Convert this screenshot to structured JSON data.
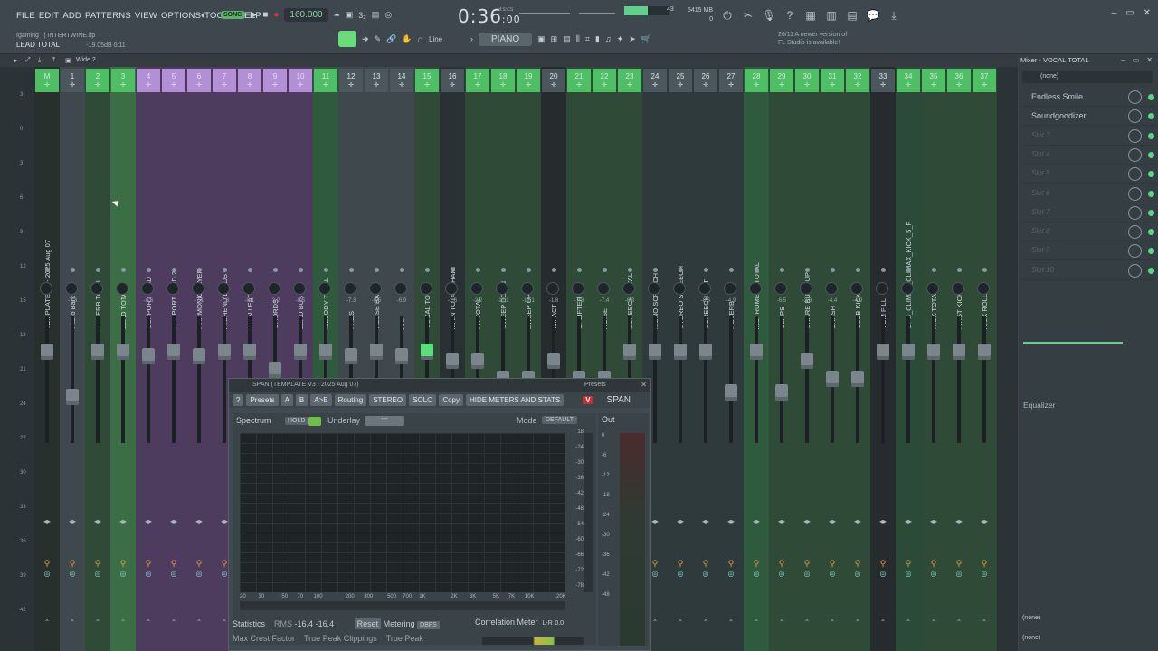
{
  "menu": [
    "FILE",
    "EDIT",
    "ADD",
    "PATTERNS",
    "VIEW",
    "OPTIONS",
    "TOOLS",
    "HELP"
  ],
  "transport": {
    "mode": "SONG",
    "tempo": "160.000"
  },
  "time": {
    "main": "0:36",
    "sub": ":00",
    "unit": "M:S:CS"
  },
  "cpu": {
    "value": "43",
    "memory": "5415 MB",
    "voices": "0"
  },
  "project": {
    "user": "Igaming",
    "file": "INTERTWINE.flp",
    "channel": "LEAD TOTAL",
    "db": "-19.05dB",
    "time": "0:11"
  },
  "toolbar": {
    "line_mode": "Line",
    "piano_label": "PIANO"
  },
  "news": {
    "line1": "26/11  A newer version of",
    "line2": "FL Studio is available!"
  },
  "subbar": {
    "wide": "Wide 2"
  },
  "ruler": [
    "3",
    "0",
    "3",
    "6",
    "9",
    "12",
    "15",
    "18",
    "21",
    "24",
    "27",
    "30",
    "33",
    "36",
    "39",
    "42"
  ],
  "strips": [
    {
      "num": "M",
      "name": "TEMPLATE V3 - 2025 Aug 07",
      "pan": "",
      "bg": "#27302d",
      "fy": 380
    },
    {
      "num": "1",
      "name": "Piano Bark",
      "pan": "-7.3",
      "bg": "#3e484d",
      "fy": 430
    },
    {
      "num": "2",
      "name": "REVERB TOTAL",
      "pan": "",
      "bg": "#2f4b38",
      "fy": 380
    },
    {
      "num": "3",
      "name": "LEAD TOTAL",
      "pan": "",
      "bg": "#3c6e46",
      "fy": 380
    },
    {
      "num": "4",
      "name": "SUPPORT LEAD",
      "pan": "-6.6",
      "bg": "#4e3c5e",
      "fy": 385
    },
    {
      "num": "5",
      "name": "SUPPORT LEAD 2",
      "pan": "",
      "bg": "#4e3c5e",
      "fy": 380
    },
    {
      "num": "6",
      "name": "HARMONIC LAYER",
      "pan": "-7.1",
      "bg": "#4e3c5e",
      "fy": 385
    },
    {
      "num": "7",
      "name": "HIGHEND LEADS",
      "pan": "-7.8",
      "bg": "#4e3c5e",
      "fy": 380
    },
    {
      "num": "8",
      "name": "MAIN LEAD",
      "pan": "-8.1",
      "bg": "#4e3c5e",
      "fy": 380
    },
    {
      "num": "9",
      "name": "CHORDS",
      "pan": "-3.2",
      "bg": "#4e3c5e",
      "fy": 400
    },
    {
      "num": "10",
      "name": "LEAD BUS",
      "pan": "-8.5",
      "bg": "#4e3c5e",
      "fy": 380
    },
    {
      "num": "11",
      "name": "MELODY TOTAL",
      "pan": "",
      "bg": "#2f5a3e",
      "fy": 380
    },
    {
      "num": "12",
      "name": "PADS",
      "pan": "-7.3",
      "bg": "#3e484d",
      "fy": 385
    },
    {
      "num": "13",
      "name": "REESE BASS",
      "pan": "-8.5",
      "bg": "#3e484d",
      "fy": 380
    },
    {
      "num": "14",
      "name": "ARP",
      "pan": "-6.9",
      "bg": "#3e484d",
      "fy": 385
    },
    {
      "num": "15",
      "name": "VOCAL TOTAL",
      "pan": "",
      "bg": "#2f4b38",
      "fy": 380,
      "active": true
    },
    {
      "num": "16",
      "name": "MAIN TOTAL CHAIN",
      "pan": "-1.6",
      "bg": "#2a3134",
      "fy": 390
    },
    {
      "num": "17",
      "name": "FX TOTAL",
      "pan": "-2.2",
      "bg": "#2f4b38",
      "fy": 390
    },
    {
      "num": "18",
      "name": "SWEEP DOWN",
      "pan": "-11.1",
      "bg": "#2f4b38",
      "fy": 410
    },
    {
      "num": "19",
      "name": "SWEEP UP",
      "pan": "-12.1",
      "bg": "#2f4b38",
      "fy": 410
    },
    {
      "num": "20",
      "name": "IMPACT",
      "pan": "-1.8",
      "bg": "#262c2e",
      "fy": 390
    },
    {
      "num": "21",
      "name": "UPLIFTER",
      "pan": "-7.8",
      "bg": "#2f4b38",
      "fy": 410
    },
    {
      "num": "22",
      "name": "NOISE",
      "pan": "-7.4",
      "bg": "#2f4b38",
      "fy": 410
    },
    {
      "num": "23",
      "name": "SCREECH TOTAL",
      "pan": "-0.3",
      "bg": "#2f4b38",
      "fy": 380
    },
    {
      "num": "24",
      "name": "MONO SCREECH",
      "pan": "",
      "bg": "#2f3a3c",
      "fy": 380
    },
    {
      "num": "25",
      "name": "STEREO SCREECH",
      "pan": "",
      "bg": "#2f3a3c",
      "fy": 380
    },
    {
      "num": "26",
      "name": "SCREECH OUT",
      "pan": "-8.5",
      "bg": "#2f3a3c",
      "fy": 380
    },
    {
      "num": "27",
      "name": "REVERB",
      "pan": "-4.9",
      "bg": "#2f3a3c",
      "fy": 425
    },
    {
      "num": "28",
      "name": "INSTRUMENT TOTAL",
      "pan": "",
      "bg": "#2f5a3e",
      "fy": 380
    },
    {
      "num": "29",
      "name": "CLAPS",
      "pan": "-6.5",
      "bg": "#2f4b38",
      "fy": 425
    },
    {
      "num": "30",
      "name": "SNARE BUILD UP",
      "pan": "-3.8",
      "bg": "#2f4b38",
      "fy": 390
    },
    {
      "num": "31",
      "name": "CRASH",
      "pan": "-4.4",
      "bg": "#2f4b38",
      "fy": 410
    },
    {
      "num": "32",
      "name": "CLUB KICK",
      "pan": "-4.9",
      "bg": "#2f4b38",
      "fy": 410
    },
    {
      "num": "33",
      "name": "TOM FILL",
      "pan": "",
      "bg": "#262c2e",
      "fy": 380
    },
    {
      "num": "34",
      "name": "OPS_CLIMAX_CLIMAX_KICK_5_F",
      "pan": "",
      "bg": "#2b4a38",
      "fy": 380
    },
    {
      "num": "35",
      "name": "KICK TOTAL",
      "pan": "",
      "bg": "#2f4b38",
      "fy": 380
    },
    {
      "num": "36",
      "name": "FIRST KICK",
      "pan": "",
      "bg": "#2f4b38",
      "fy": 380
    },
    {
      "num": "37",
      "name": "KICK ROLLS",
      "pan": "",
      "bg": "#2f4b38",
      "fy": 380
    }
  ],
  "right_panel": {
    "title": "Mixer - VOCAL TOTAL",
    "preset": "(none)",
    "slots": [
      {
        "label": "Endless Smile",
        "dim": false
      },
      {
        "label": "Soundgoodizer",
        "dim": false
      },
      {
        "label": "Slot 3",
        "dim": true
      },
      {
        "label": "Slot 4",
        "dim": true
      },
      {
        "label": "Slot 5",
        "dim": true
      },
      {
        "label": "Slot 6",
        "dim": true
      },
      {
        "label": "Slot 7",
        "dim": true
      },
      {
        "label": "Slot 8",
        "dim": true
      },
      {
        "label": "Slot 9",
        "dim": true
      },
      {
        "label": "Slot 10",
        "dim": true
      }
    ],
    "equalizer": "Equalizer",
    "in": "(none)",
    "out": "(none)"
  },
  "span": {
    "title": "SPAN (TEMPLATE V3 - 2025 Aug 07)",
    "presets": "Presets",
    "toolbar": [
      "?",
      "Presets",
      "A",
      "B",
      "A>B",
      "Routing",
      "STEREO",
      "SOLO",
      "Copy",
      "HIDE METERS AND STATS"
    ],
    "brand": "SPAN",
    "spectrum": "Spectrum",
    "hold": "HOLD",
    "underlay": "Underlay",
    "underlay_val": "---",
    "mode": "Mode",
    "mode_val": "DEFAULT",
    "out": "Out",
    "yticks": [
      "18",
      "24",
      "30",
      "36",
      "42",
      "48",
      "54",
      "60",
      "66",
      "72",
      "78"
    ],
    "xticks": [
      "20",
      "30",
      "50",
      "70",
      "100",
      "200",
      "300",
      "500",
      "700",
      "1K",
      "2K",
      "3K",
      "5K",
      "7K",
      "10K",
      "20K"
    ],
    "out_scale": [
      "0",
      "6",
      "12",
      "18",
      "24",
      "30",
      "36",
      "42",
      "48"
    ],
    "stats": {
      "label": "Statistics",
      "rms": "RMS",
      "rms_l": "-16.4",
      "rms_r": "-16.4",
      "reset": "Reset",
      "metering": "Metering",
      "dbfs": "DBFS",
      "crest": "Max Crest Factor",
      "clip": "True Peak Clippings",
      "peak": "True Peak"
    },
    "corr": {
      "label": "Correlation Meter",
      "lr": "L-R",
      "val": "0.0"
    }
  }
}
